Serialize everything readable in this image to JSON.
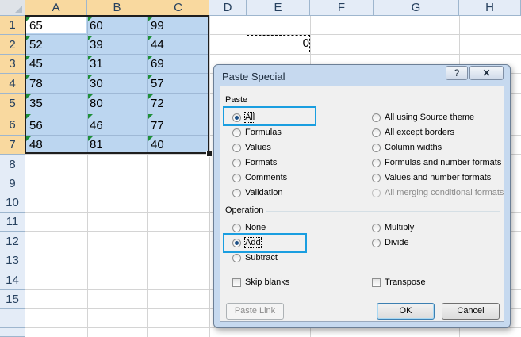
{
  "sheet": {
    "columns": [
      "A",
      "B",
      "C",
      "D",
      "E",
      "F",
      "G",
      "H"
    ],
    "rows": [
      "1",
      "2",
      "3",
      "4",
      "5",
      "6",
      "7",
      "8",
      "9",
      "10",
      "11",
      "12",
      "13",
      "14",
      "15"
    ],
    "data": [
      [
        "65",
        "60",
        "99"
      ],
      [
        "52",
        "39",
        "44"
      ],
      [
        "45",
        "31",
        "69"
      ],
      [
        "78",
        "30",
        "57"
      ],
      [
        "35",
        "80",
        "72"
      ],
      [
        "56",
        "46",
        "77"
      ],
      [
        "48",
        "81",
        "40"
      ]
    ],
    "copied_cell_value": "0"
  },
  "dialog": {
    "title": "Paste Special",
    "help_icon": "?",
    "close_icon": "x",
    "paste_group": "Paste",
    "paste_options_left": [
      "All",
      "Formulas",
      "Values",
      "Formats",
      "Comments",
      "Validation"
    ],
    "paste_options_right": [
      "All using Source theme",
      "All except borders",
      "Column widths",
      "Formulas and number formats",
      "Values and number formats",
      "All merging conditional formats"
    ],
    "paste_selected": "All",
    "operation_group": "Operation",
    "operation_options_left": [
      "None",
      "Add",
      "Subtract"
    ],
    "operation_options_right": [
      "Multiply",
      "Divide"
    ],
    "operation_selected": "Add",
    "skip_blanks": "Skip blanks",
    "transpose": "Transpose",
    "paste_link": "Paste Link",
    "ok": "OK",
    "cancel": "Cancel",
    "highlight_color": "#1a9ee0"
  }
}
